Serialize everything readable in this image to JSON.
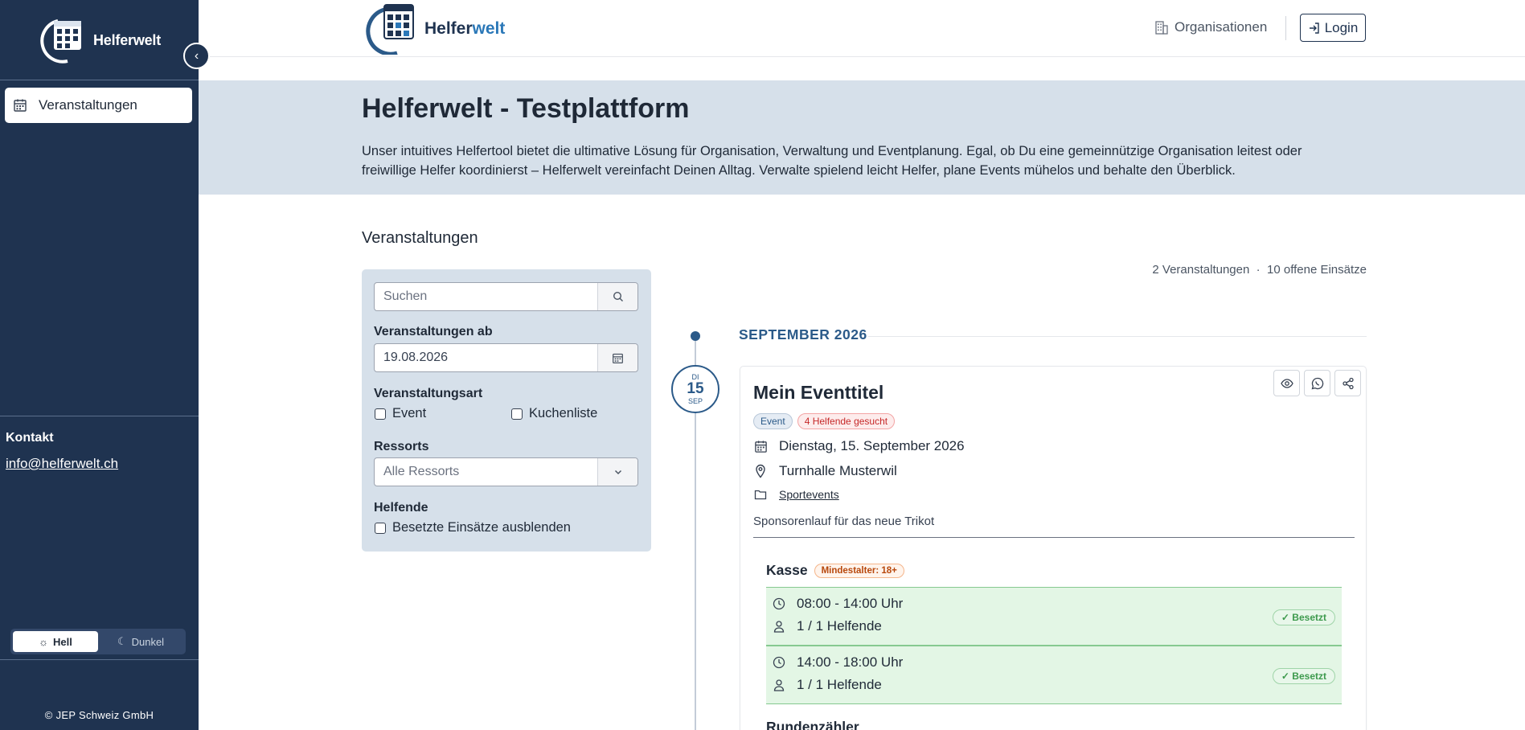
{
  "app": {
    "name": "Helferwelt",
    "name_part1": "Helfer",
    "name_part2": "welt"
  },
  "sidebar": {
    "nav": [
      {
        "label": "Veranstaltungen",
        "icon": "calendar-icon"
      }
    ],
    "kontakt_title": "Kontakt",
    "kontakt_email": "info@helferwelt.ch",
    "theme": {
      "light": "Hell",
      "dark": "Dunkel",
      "active": "light"
    },
    "copyright": "© JEP Schweiz GmbH"
  },
  "header": {
    "organisationen": "Organisationen",
    "login": "Login"
  },
  "hero": {
    "title": "Helferwelt - Testplattform",
    "text": "Unser intuitives Helfertool bietet die ultimative Lösung für Organisation, Verwaltung und Eventplanung. Egal, ob Du eine gemeinnützige Organisation leitest oder freiwillige Helfer koordinierst – Helferwelt vereinfacht Deinen Alltag. Verwalte spielend leicht Helfer, plane Events mühelos und behalte den Überblick."
  },
  "section_title": "Veranstaltungen",
  "filter": {
    "search_placeholder": "Suchen",
    "date_label": "Veranstaltungen ab",
    "date_value": "19.08.2026",
    "type_label": "Veranstaltungsart",
    "type_options": [
      "Event",
      "Kuchenliste"
    ],
    "ressorts_label": "Ressorts",
    "ressorts_value": "Alle Ressorts",
    "helpers_label": "Helfende",
    "helpers_option": "Besetzte Einsätze ausblenden"
  },
  "summary": {
    "events": "2 Veranstaltungen",
    "separator": "·",
    "open": "10 offene Einsätze"
  },
  "timeline": {
    "month": "SEPTEMBER 2026",
    "date": {
      "weekday": "DI",
      "day": "15",
      "month": "SEP"
    }
  },
  "event": {
    "title": "Mein Eventtitel",
    "badge_type": "Event",
    "badge_needed": "4 Helfende gesucht",
    "date": "Dienstag, 15. September 2026",
    "location": "Turnhalle Musterwil",
    "category": "Sportevents",
    "description": "Sponsorenlauf für das neue Trikot",
    "shifts": [
      {
        "title": "Kasse",
        "age_badge": "Mindestalter: 18+",
        "slots": [
          {
            "time": "08:00 - 14:00 Uhr",
            "helpers": "1 / 1 Helfende",
            "status": "✓ Besetzt"
          },
          {
            "time": "14:00 - 18:00 Uhr",
            "helpers": "1 / 1 Helfende",
            "status": "✓ Besetzt"
          }
        ]
      },
      {
        "title": "Rundenzähler"
      }
    ]
  },
  "colors": {
    "sidebar": "#1f3350",
    "hero": "#d6e0ea",
    "accent": "#2b5a89",
    "slot_ok": "#e3f6e5"
  }
}
